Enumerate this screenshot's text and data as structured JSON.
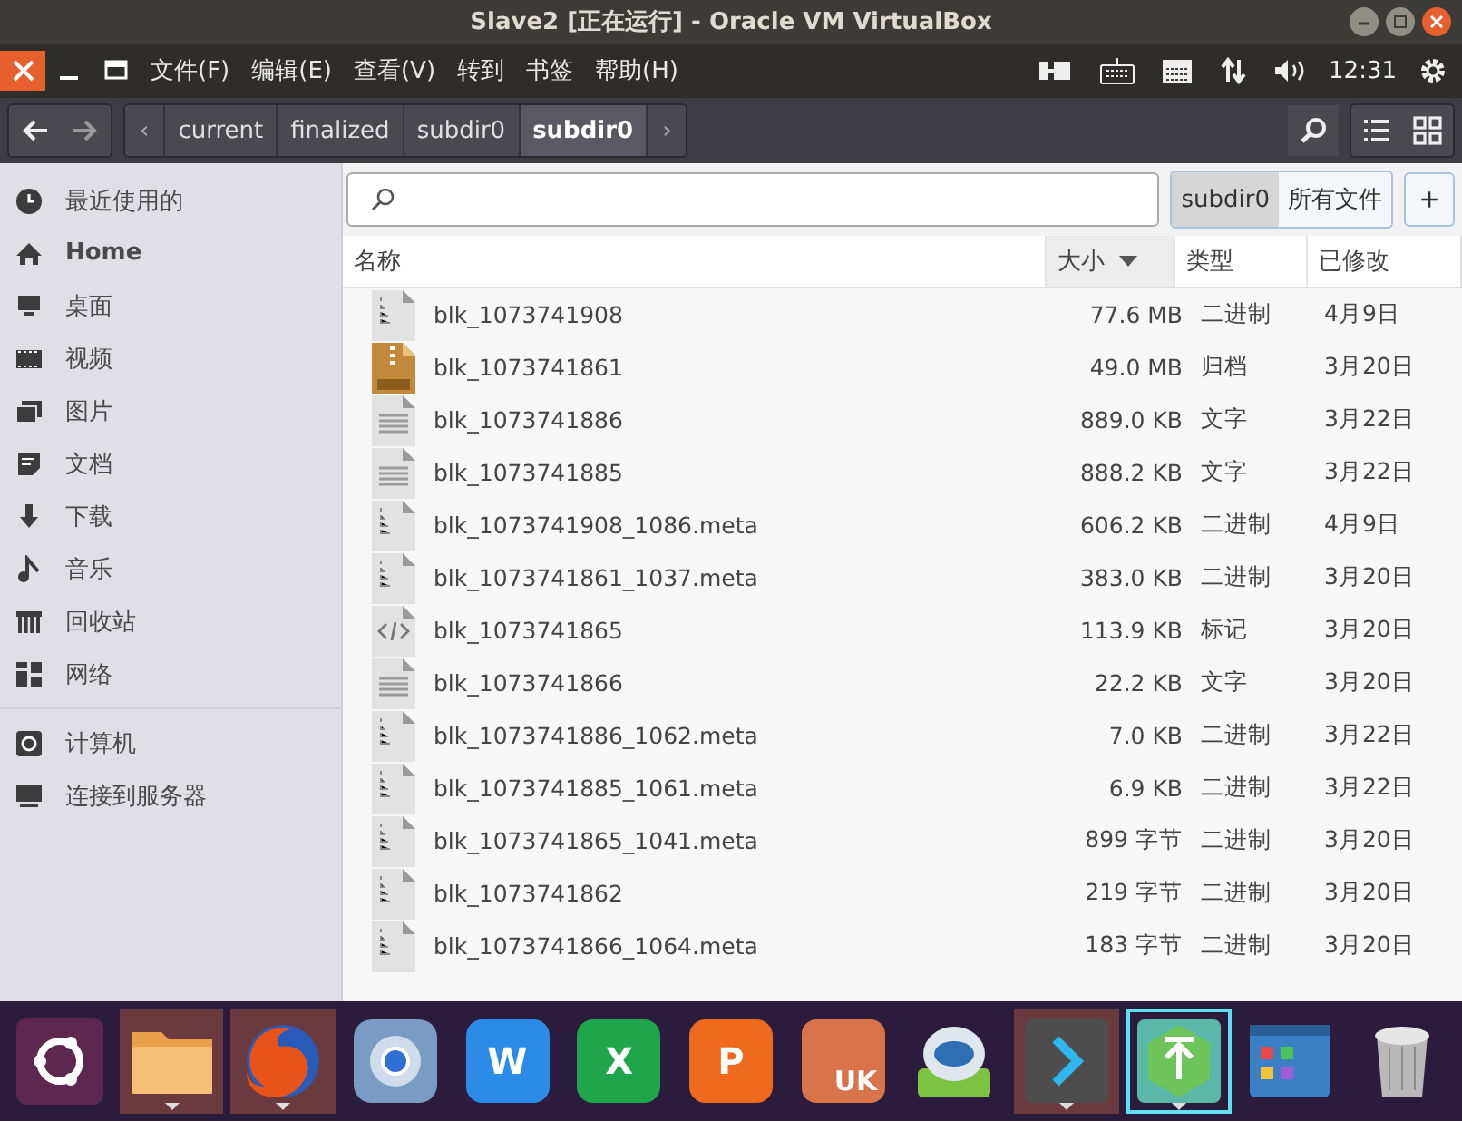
{
  "window": {
    "title": "Slave2 [正在运行] - Oracle VM VirtualBox"
  },
  "menu_bar": {
    "items": [
      "文件(F)",
      "编辑(E)",
      "查看(V)",
      "转到",
      "书签",
      "帮助(H)"
    ],
    "clock": "12:31"
  },
  "path_bar": {
    "scroll_left": "‹",
    "scroll_right": "›",
    "segments": [
      {
        "label": "current",
        "selected": false
      },
      {
        "label": "finalized",
        "selected": false
      },
      {
        "label": "subdir0",
        "selected": false
      },
      {
        "label": "subdir0",
        "selected": true
      }
    ]
  },
  "sidebar": {
    "groups": [
      [
        {
          "label": "最近使用的",
          "kind": "recent"
        },
        {
          "label": "Home",
          "kind": "home"
        },
        {
          "label": "桌面",
          "kind": "desktop"
        },
        {
          "label": "视频",
          "kind": "video"
        },
        {
          "label": "图片",
          "kind": "pictures"
        },
        {
          "label": "文档",
          "kind": "documents"
        },
        {
          "label": "下载",
          "kind": "downloads"
        },
        {
          "label": "音乐",
          "kind": "music"
        },
        {
          "label": "回收站",
          "kind": "trash"
        },
        {
          "label": "网络",
          "kind": "network"
        }
      ],
      [
        {
          "label": "计算机",
          "kind": "computer"
        },
        {
          "label": "连接到服务器",
          "kind": "server"
        }
      ]
    ]
  },
  "search_bar": {
    "scopes": [
      {
        "label": "subdir0",
        "selected": true
      },
      {
        "label": "所有文件",
        "selected": false
      }
    ],
    "add": "+"
  },
  "table": {
    "columns": [
      {
        "label": "名称",
        "sorted": false
      },
      {
        "label": "大小",
        "sorted": true
      },
      {
        "label": "类型",
        "sorted": false
      },
      {
        "label": "已修改",
        "sorted": false
      }
    ],
    "rows": [
      {
        "kind": "binary",
        "name": "blk_1073741908",
        "size": "77.6 MB",
        "type": "二进制",
        "modified": "4月9日"
      },
      {
        "kind": "zip",
        "name": "blk_1073741861",
        "size": "49.0 MB",
        "type": "归档",
        "modified": "3月20日"
      },
      {
        "kind": "text",
        "name": "blk_1073741886",
        "size": "889.0 KB",
        "type": "文字",
        "modified": "3月22日"
      },
      {
        "kind": "text",
        "name": "blk_1073741885",
        "size": "888.2 KB",
        "type": "文字",
        "modified": "3月22日"
      },
      {
        "kind": "binary",
        "name": "blk_1073741908_1086.meta",
        "size": "606.2 KB",
        "type": "二进制",
        "modified": "4月9日"
      },
      {
        "kind": "binary",
        "name": "blk_1073741861_1037.meta",
        "size": "383.0 KB",
        "type": "二进制",
        "modified": "3月20日"
      },
      {
        "kind": "markup",
        "name": "blk_1073741865",
        "size": "113.9 KB",
        "type": "标记",
        "modified": "3月20日"
      },
      {
        "kind": "text",
        "name": "blk_1073741866",
        "size": "22.2 KB",
        "type": "文字",
        "modified": "3月20日"
      },
      {
        "kind": "binary",
        "name": "blk_1073741886_1062.meta",
        "size": "7.0 KB",
        "type": "二进制",
        "modified": "3月22日"
      },
      {
        "kind": "binary",
        "name": "blk_1073741885_1061.meta",
        "size": "6.9 KB",
        "type": "二进制",
        "modified": "3月22日"
      },
      {
        "kind": "binary",
        "name": "blk_1073741865_1041.meta",
        "size": "899 字节",
        "type": "二进制",
        "modified": "3月20日"
      },
      {
        "kind": "binary",
        "name": "blk_1073741862",
        "size": "219 字节",
        "type": "二进制",
        "modified": "3月20日"
      },
      {
        "kind": "binary",
        "name": "blk_1073741866_1064.meta",
        "size": "183 字节",
        "type": "二进制",
        "modified": "3月20日"
      }
    ]
  },
  "dock": {
    "items": [
      {
        "kind": "ubuntu",
        "running": false,
        "highlighted": false,
        "selected": false
      },
      {
        "kind": "folder",
        "running": true,
        "highlighted": true,
        "selected": false
      },
      {
        "kind": "firefox",
        "running": true,
        "highlighted": true,
        "selected": false
      },
      {
        "kind": "browser",
        "running": false,
        "highlighted": false,
        "selected": false
      },
      {
        "kind": "office",
        "label": "W",
        "color": "#2b8be6",
        "running": false,
        "highlighted": false,
        "selected": false
      },
      {
        "kind": "office",
        "label": "X",
        "color": "#1fa64a",
        "running": false,
        "highlighted": false,
        "selected": false
      },
      {
        "kind": "office",
        "label": "P",
        "color": "#f06a1d",
        "running": false,
        "highlighted": false,
        "selected": false
      },
      {
        "kind": "bag",
        "label": "UK",
        "running": false,
        "highlighted": false,
        "selected": false
      },
      {
        "kind": "robot",
        "running": false,
        "highlighted": false,
        "selected": false
      },
      {
        "kind": "arrow",
        "running": true,
        "highlighted": true,
        "selected": false
      },
      {
        "kind": "upload",
        "running": true,
        "highlighted": false,
        "selected": true
      },
      {
        "kind": "apps",
        "running": false,
        "highlighted": false,
        "selected": false
      },
      {
        "kind": "trash",
        "running": false,
        "highlighted": false,
        "selected": false
      }
    ]
  }
}
